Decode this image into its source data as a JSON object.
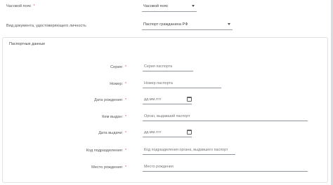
{
  "timezone": {
    "label": "Часовой пояс",
    "value": "Часовой пояс"
  },
  "document_type": {
    "label": "Вид документа, удостоверяющего личность",
    "value": "Паспорт гражданина РФ"
  },
  "passport": {
    "title": "Паспортные данные",
    "fields": [
      {
        "label": "Серия:",
        "placeholder": "Серия паспорта"
      },
      {
        "label": "Номер:",
        "placeholder": "Номер паспорта"
      },
      {
        "label": "Дата рождения:",
        "placeholder": "дд.мм.гггг"
      },
      {
        "label": "Кем выдан:",
        "placeholder": "Орган, выдавший паспорт"
      },
      {
        "label": "Дата выдачи:",
        "placeholder": "дд.мм.гггг"
      },
      {
        "label": "Код подразделения:",
        "placeholder": "Код подразделения органа, выдавшего паспорт"
      },
      {
        "label": "Место рождения:",
        "placeholder": "Место рождения"
      }
    ]
  },
  "required_mark": "*"
}
